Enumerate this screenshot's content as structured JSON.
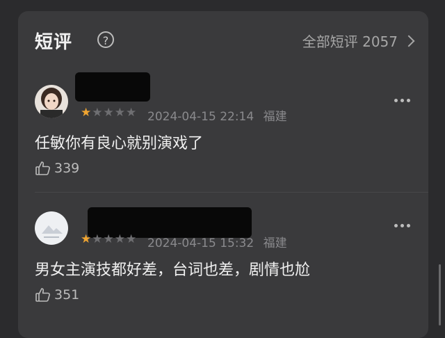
{
  "section": {
    "title": "短评",
    "help_icon": "question-circle-icon",
    "all_link": "全部短评 2057"
  },
  "comments": [
    {
      "rating": 1,
      "date": "2024-04-15 22:14",
      "location": "福建",
      "text": "任敏你有良心就别演戏了",
      "likes": "339"
    },
    {
      "rating": 1,
      "date": "2024-04-15 15:32",
      "location": "福建",
      "text": "男女主演技都好差，台词也差，剧情也尬",
      "likes": "351"
    }
  ],
  "colors": {
    "background": "#2b2b2d",
    "card": "#3a3a3c",
    "star_active": "#f0a531",
    "star_inactive": "#6f6f72"
  }
}
